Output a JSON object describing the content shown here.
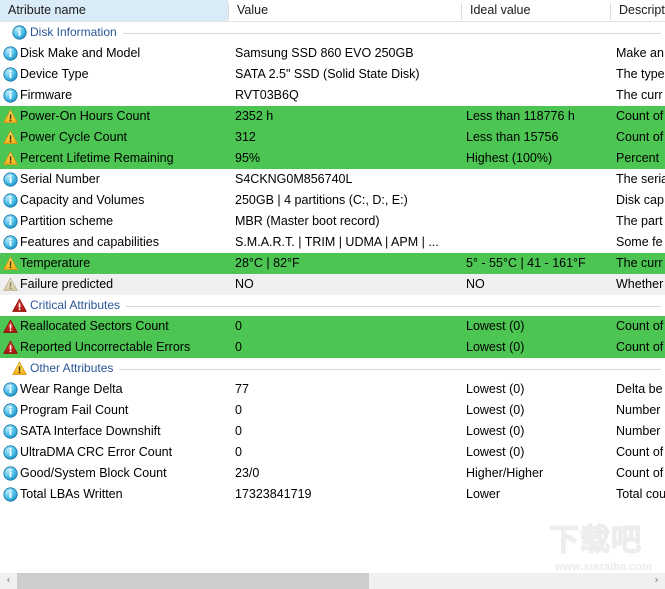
{
  "header": {
    "columns": [
      {
        "label": "Atribute name",
        "selected": true
      },
      {
        "label": "Value",
        "selected": false
      },
      {
        "label": "Ideal value",
        "selected": false
      },
      {
        "label": "Descript",
        "selected": false
      }
    ]
  },
  "sections": [
    {
      "id": "disk-information",
      "label": "Disk Information",
      "icon": "info-icon",
      "rows": [
        {
          "icon": "info-icon",
          "name": "Disk Make and Model",
          "value": "Samsung SSD 860 EVO 250GB",
          "ideal": "",
          "desc": "Make an",
          "state": "plain"
        },
        {
          "icon": "info-icon",
          "name": "Device Type",
          "value": "SATA  2.5\" SSD (Solid State Disk)",
          "ideal": "",
          "desc": "The type",
          "state": "plain"
        },
        {
          "icon": "info-icon",
          "name": "Firmware",
          "value": "RVT03B6Q",
          "ideal": "",
          "desc": "The curr",
          "state": "plain"
        },
        {
          "icon": "warning-icon",
          "name": "Power-On Hours Count",
          "value": "2352 h",
          "ideal": "Less than 118776 h",
          "desc": "Count of",
          "state": "green"
        },
        {
          "icon": "warning-icon",
          "name": "Power Cycle Count",
          "value": "312",
          "ideal": "Less than 15756",
          "desc": "Count of",
          "state": "green"
        },
        {
          "icon": "warning-icon",
          "name": "Percent Lifetime Remaining",
          "value": "95%",
          "ideal": "Highest (100%)",
          "desc": "Percent",
          "state": "green"
        },
        {
          "icon": "info-icon",
          "name": "Serial Number",
          "value": "S4CKNG0M856740L",
          "ideal": "",
          "desc": "The seria",
          "state": "plain"
        },
        {
          "icon": "info-icon",
          "name": "Capacity and Volumes",
          "value": "250GB | 4 partitions (C:, D:, E:)",
          "ideal": "",
          "desc": "Disk cap",
          "state": "plain"
        },
        {
          "icon": "info-icon",
          "name": "Partition scheme",
          "value": "MBR (Master boot record)",
          "ideal": "",
          "desc": "The part",
          "state": "plain"
        },
        {
          "icon": "info-icon",
          "name": "Features and capabilities",
          "value": "S.M.A.R.T. | TRIM | UDMA | APM | ...",
          "ideal": "",
          "desc": "Some fe",
          "state": "plain"
        },
        {
          "icon": "warning-icon",
          "name": "Temperature",
          "value": "28°C | 82°F",
          "ideal": "5° - 55°C | 41 - 161°F",
          "desc": "The curr",
          "state": "green"
        },
        {
          "icon": "warning-faded-icon",
          "name": "Failure predicted",
          "value": "NO",
          "ideal": "NO",
          "desc": "Whether",
          "state": "gray"
        }
      ]
    },
    {
      "id": "critical-attributes",
      "label": "Critical Attributes",
      "icon": "critical-icon",
      "rows": [
        {
          "icon": "critical-icon",
          "name": "Reallocated Sectors Count",
          "value": "0",
          "ideal": "Lowest (0)",
          "desc": "Count of",
          "state": "green"
        },
        {
          "icon": "critical-icon",
          "name": "Reported Uncorrectable Errors",
          "value": "0",
          "ideal": "Lowest (0)",
          "desc": "Count of",
          "state": "green"
        }
      ]
    },
    {
      "id": "other-attributes",
      "label": "Other Attributes",
      "icon": "warning-icon",
      "rows": [
        {
          "icon": "info-icon",
          "name": "Wear Range Delta",
          "value": "77",
          "ideal": "Lowest (0)",
          "desc": "Delta be",
          "state": "plain"
        },
        {
          "icon": "info-icon",
          "name": "Program Fail Count",
          "value": "0",
          "ideal": "Lowest (0)",
          "desc": "Number",
          "state": "plain"
        },
        {
          "icon": "info-icon",
          "name": "SATA Interface Downshift",
          "value": "0",
          "ideal": "Lowest (0)",
          "desc": "Number",
          "state": "plain"
        },
        {
          "icon": "info-icon",
          "name": "UltraDMA CRC Error Count",
          "value": "0",
          "ideal": "Lowest (0)",
          "desc": "Count of",
          "state": "plain"
        },
        {
          "icon": "info-icon",
          "name": "Good/System Block Count",
          "value": "23/0",
          "ideal": "Higher/Higher",
          "desc": "Count of",
          "state": "plain"
        },
        {
          "icon": "info-icon",
          "name": "Total LBAs Written",
          "value": "17323841719",
          "ideal": "Lower",
          "desc": "Total cou",
          "state": "plain"
        }
      ]
    }
  ],
  "scrollbar": {
    "left_arrow": "‹",
    "right_arrow": "›"
  },
  "watermark": {
    "logo_text": "下载吧",
    "url": "www.xiazaiba.com"
  },
  "colors": {
    "row_green": "#4cc552",
    "row_gray": "#f0f0f0",
    "header_selected": "#d9ebf7",
    "section_label": "#2a5699"
  }
}
